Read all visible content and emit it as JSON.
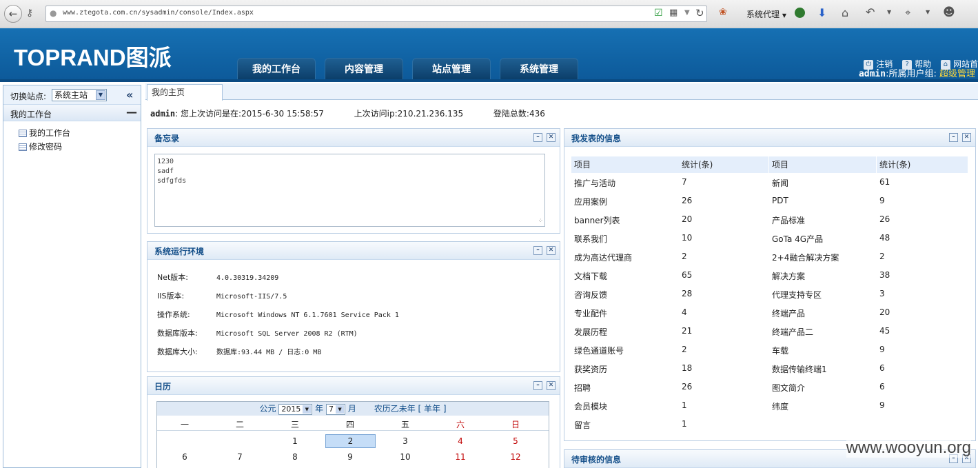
{
  "browser": {
    "url": "www.ztegota.com.cn/sysadmin/console/Index.aspx",
    "proxy_label": "系统代理"
  },
  "header": {
    "logo": "TOPRAND图派",
    "user_prefix": "admin",
    "user_mid": ":所属用户组: ",
    "user_group": "超级管理",
    "logout": "注销",
    "help": "帮助",
    "site_home": "网站首"
  },
  "nav": [
    "我的工作台",
    "内容管理",
    "站点管理",
    "系统管理"
  ],
  "sidebar": {
    "site_label": "切换站点:",
    "site_value": "系统主站",
    "section": "我的工作台",
    "items": [
      "我的工作台",
      "修改密码"
    ]
  },
  "tab": "我的主页",
  "info": {
    "user": "admin",
    "last_visit": ": 您上次访问是在:2015-6-30 15:58:57",
    "last_ip": "上次访问ip:210.21.236.135",
    "login_count": "登陆总数:436"
  },
  "memo": {
    "title": "备忘录",
    "lines": [
      "1230",
      "sadf",
      "sdfgfds"
    ]
  },
  "env": {
    "title": "系统运行环境",
    "rows": [
      {
        "k": "Net版本:",
        "v": "4.0.30319.34209"
      },
      {
        "k": "IIS版本:",
        "v": "Microsoft-IIS/7.5"
      },
      {
        "k": "操作系统:",
        "v": "Microsoft Windows NT 6.1.7601 Service Pack 1"
      },
      {
        "k": "数据库版本:",
        "v": "Microsoft SQL Server 2008 R2 (RTM)"
      },
      {
        "k": "数据库大小:",
        "v": "数据库:93.44 MB   / 日志:0 MB"
      }
    ]
  },
  "calendar": {
    "title": "日历",
    "era": "公元",
    "year": "2015",
    "year_unit": "年",
    "month": "7",
    "month_unit": "月",
    "lunar": "农历乙未年 [ 羊年 ]",
    "weekdays": [
      "一",
      "二",
      "三",
      "四",
      "五",
      "六",
      "日"
    ],
    "row1": [
      "",
      "",
      "1",
      "2",
      "3",
      "4",
      "5"
    ],
    "row2": [
      "6",
      "7",
      "8",
      "9",
      "10",
      "11",
      "12"
    ]
  },
  "stats": {
    "title": "我发表的信息",
    "headers": [
      "项目",
      "统计(条)",
      "项目",
      "统计(条)"
    ],
    "left": [
      [
        "推广与活动",
        "7"
      ],
      [
        "应用案例",
        "26"
      ],
      [
        "banner列表",
        "20"
      ],
      [
        "联系我们",
        "10"
      ],
      [
        "成为高达代理商",
        "2"
      ],
      [
        "文档下载",
        "65"
      ],
      [
        "咨询反馈",
        "28"
      ],
      [
        "专业配件",
        "4"
      ],
      [
        "发展历程",
        "21"
      ],
      [
        "绿色通道账号",
        "2"
      ],
      [
        "获奖资历",
        "18"
      ],
      [
        "招聘",
        "26"
      ],
      [
        "会员模块",
        "1"
      ],
      [
        "留言",
        "1"
      ]
    ],
    "right": [
      [
        "新闻",
        "61"
      ],
      [
        "PDT",
        "9"
      ],
      [
        "产品标准",
        "26"
      ],
      [
        "GoTa 4G产品",
        "48"
      ],
      [
        "2+4融合解决方案",
        "2"
      ],
      [
        "解决方案",
        "38"
      ],
      [
        "代理支持专区",
        "3"
      ],
      [
        "终端产品",
        "20"
      ],
      [
        "终端产品二",
        "45"
      ],
      [
        "车载",
        "9"
      ],
      [
        "数据传输终端1",
        "6"
      ],
      [
        "图文简介",
        "6"
      ],
      [
        "纬度",
        "9"
      ]
    ]
  },
  "pending": {
    "title": "待审核的信息"
  },
  "watermark": "www.wooyun.org"
}
